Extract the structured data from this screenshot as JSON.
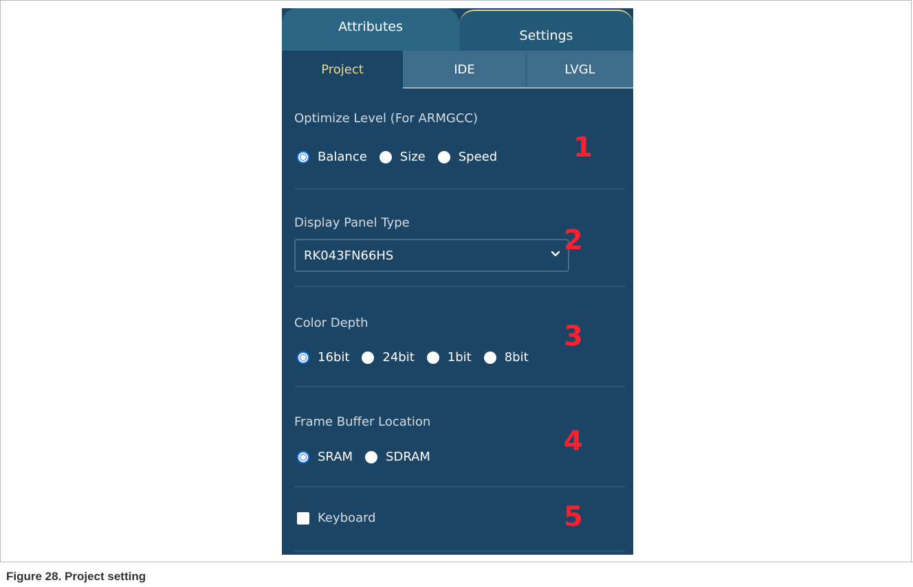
{
  "tabs": {
    "attributes": "Attributes",
    "settings": "Settings"
  },
  "subtabs": {
    "project": "Project",
    "ide": "IDE",
    "lvgl": "LVGL"
  },
  "optimize": {
    "label": "Optimize Level (For ARMGCC)",
    "options": [
      "Balance",
      "Size",
      "Speed"
    ],
    "selected": "Balance"
  },
  "display_panel": {
    "label": "Display Panel Type",
    "value": "RK043FN66HS"
  },
  "color_depth": {
    "label": "Color Depth",
    "options": [
      "16bit",
      "24bit",
      "1bit",
      "8bit"
    ],
    "selected": "16bit"
  },
  "frame_buffer": {
    "label": "Frame Buffer Location",
    "options": [
      "SRAM",
      "SDRAM"
    ],
    "selected": "SRAM"
  },
  "keyboard": {
    "label": "Keyboard",
    "checked": false
  },
  "annotations": [
    "1",
    "2",
    "3",
    "4",
    "5"
  ],
  "caption": "Figure 28.  Project setting",
  "colors": {
    "panel_bg": "#1c4464",
    "tab_bg": "#2b6784",
    "accent_text": "#efd995",
    "annotation_red": "#ff1f2e",
    "radio_selected": "#1a73e8"
  }
}
